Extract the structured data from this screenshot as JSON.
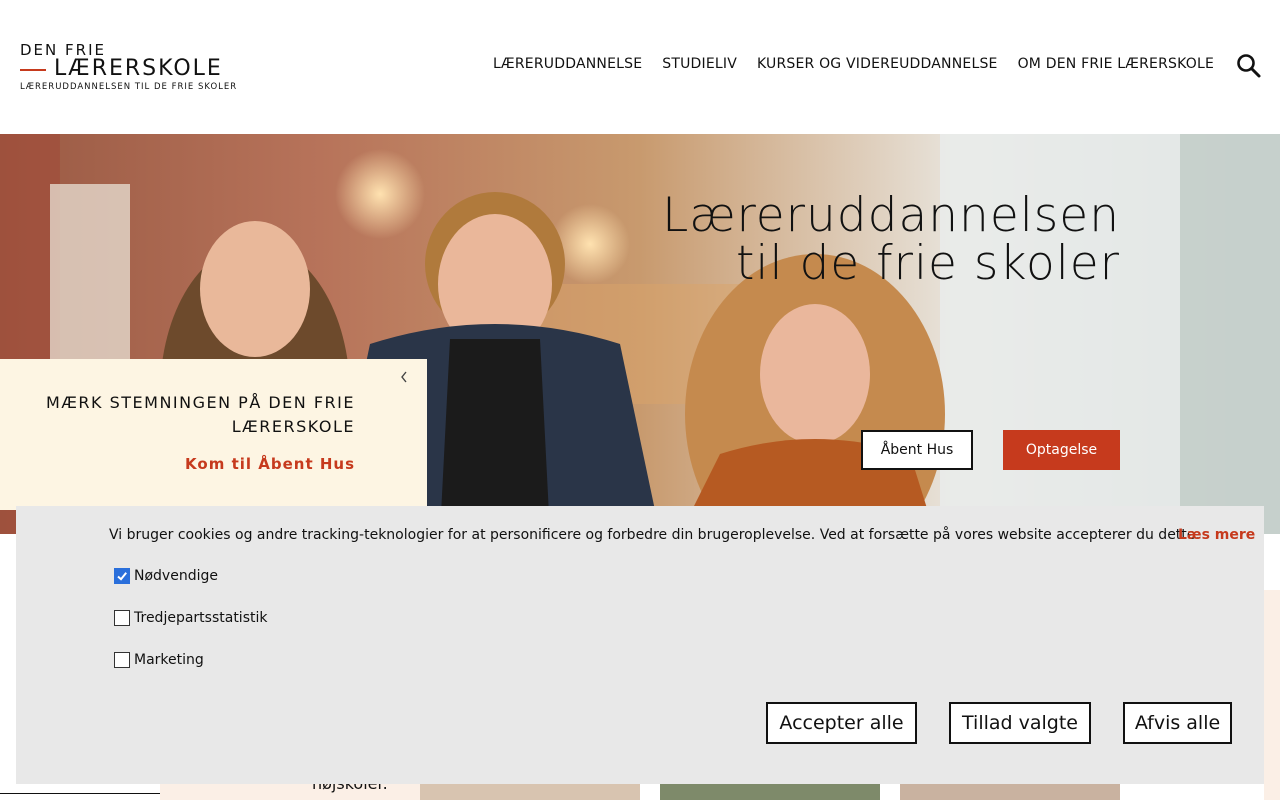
{
  "logo": {
    "line1": "DEN FRIE",
    "line2": "LÆRERSKOLE",
    "tagline": "LÆRERUDDANNELSEN TIL DE FRIE SKOLER"
  },
  "nav": {
    "items": [
      {
        "label": "LÆRERUDDANNELSE"
      },
      {
        "label": "STUDIELIV"
      },
      {
        "label": "KURSER OG VIDEREUDDANNELSE"
      },
      {
        "label": "OM DEN FRIE LÆRERSKOLE"
      }
    ],
    "search_icon": "search-icon"
  },
  "hero": {
    "title_line1": "Læreruddannelsen",
    "title_line2": "til de frie skoler",
    "btn_open_house": "Åbent Hus",
    "btn_apply": "Optagelse"
  },
  "promo": {
    "title": "MÆRK STEMNINGEN PÅ DEN FRIE LÆRERSKOLE",
    "link": "Kom til Åbent Hus",
    "close_icon": "chevron-left-icon"
  },
  "lower": {
    "text": "højskoler."
  },
  "cookie": {
    "message": "Vi bruger cookies og andre tracking-teknologier for at personificere og forbedre din brugeroplevelse. Ved at forsætte på vores website accepterer du dette.",
    "read_more": "Læs mere",
    "options": [
      {
        "label": "Nødvendige",
        "checked": true
      },
      {
        "label": "Tredjepartsstatistik",
        "checked": false
      },
      {
        "label": "Marketing",
        "checked": false
      }
    ],
    "accept_all": "Accepter alle",
    "allow_selected": "Tillad valgte",
    "reject_all": "Afvis alle"
  },
  "colors": {
    "accent": "#c63a1d",
    "promo_bg": "#fdf5e3",
    "cookie_bg": "#e8e8e8",
    "checkbox_checked": "#2a6fdb"
  }
}
